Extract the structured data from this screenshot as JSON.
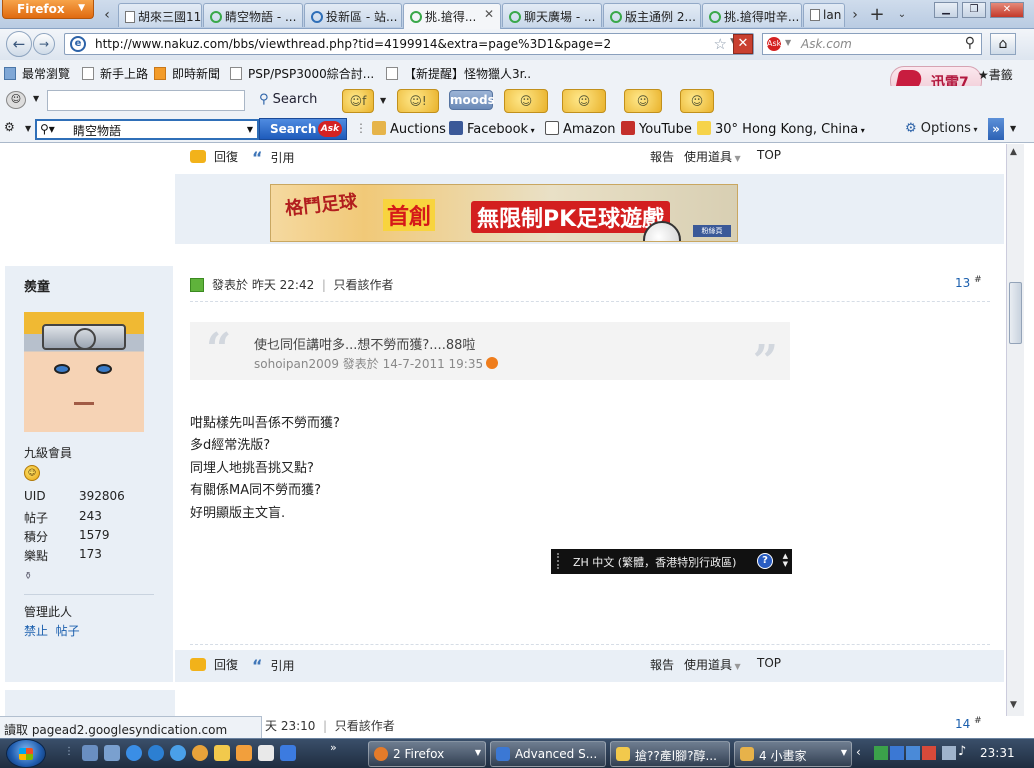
{
  "browser": {
    "menu_label": "Firefox",
    "tabs": [
      {
        "label": "胡來三國11...",
        "icon": "doc-icon"
      },
      {
        "label": "睛空物語 - ...",
        "icon": "loading-icon"
      },
      {
        "label": "投新區 - 站...",
        "icon": "globe-icon"
      },
      {
        "label": "挑.搶得...",
        "icon": "loading-icon",
        "active": true
      },
      {
        "label": "聊天廣場 - ...",
        "icon": "loading-icon"
      },
      {
        "label": "版主通例 2...",
        "icon": "loading-icon"
      },
      {
        "label": "挑.搶得咁辛...",
        "icon": "loading-icon"
      },
      {
        "label": "lan",
        "icon": "doc-icon"
      }
    ],
    "url": "http://www.nakuz.com/bbs/viewthread.php?tid=4199914&extra=page%3D1&page=2",
    "ask_placeholder": "Ask.com",
    "ask_logo": "Ask",
    "bookmarks": [
      "最常瀏覽",
      "新手上路",
      "即時新聞",
      "PSP/PSP3000綜合討...",
      "【新提醒】怪物獵人3r.."
    ],
    "bookmarks_right": "書籤",
    "xunlei_label": "迅雷7",
    "toolbar1": {
      "search_label": "Search",
      "moods_label": "moods"
    },
    "toolbar2": {
      "search_value": "睛空物語",
      "search_button": "Search",
      "search_button_logo": "Ask",
      "items": [
        "Auctions",
        "Facebook",
        "Amazon",
        "YouTube",
        "30° Hong Kong, China"
      ],
      "options": "Options"
    },
    "status_text": "讀取 pagead2.googlesyndication.com"
  },
  "banner": {
    "t1": "格鬥足球",
    "t2": "首創",
    "t3": "無限制PK足球遊戲",
    "fb": "粉絲頁"
  },
  "post_actions": {
    "reply": "回復",
    "quote": "引用",
    "report": "報告",
    "tools": "使用道具",
    "top": "TOP"
  },
  "user": {
    "name": "羨童",
    "rank": "九級會員",
    "stats": [
      {
        "label": "UID",
        "value": "392806"
      },
      {
        "label": "帖子",
        "value": "243"
      },
      {
        "label": "積分",
        "value": "1579"
      },
      {
        "label": "樂點",
        "value": "173"
      }
    ],
    "manage_label": "管理此人",
    "ban_link": "禁止",
    "posts_link": "帖子"
  },
  "post": {
    "posted_label": "發表於 昨天 22:42",
    "sep": "|",
    "only_author": "只看該作者",
    "number": "13",
    "number_sup": "#",
    "quote_text": "使乜同佢講咁多...想不勞而獲?....88啦",
    "quote_meta": "sohoipan2009 發表於 14-7-2011 19:35",
    "body_lines": [
      "咁點樣先叫吾係不勞而獲?",
      "多d經常洗版?",
      "同埋人地挑吾挑又點?",
      "有關係MA同不勞而獲?",
      "好明顯版主文盲."
    ]
  },
  "next_post": {
    "posted_label": "天 23:10",
    "sep": "|",
    "only_author": "只看該作者",
    "number": "14",
    "number_sup": "#"
  },
  "ime_tooltip": "ZH 中文 (繁體，香港特別行政區)",
  "taskbar": {
    "tasks": [
      "2 Firefox",
      "Advanced S...",
      "搶??產l腳?醇...",
      "4 小畫家"
    ],
    "clock": "23:31"
  }
}
